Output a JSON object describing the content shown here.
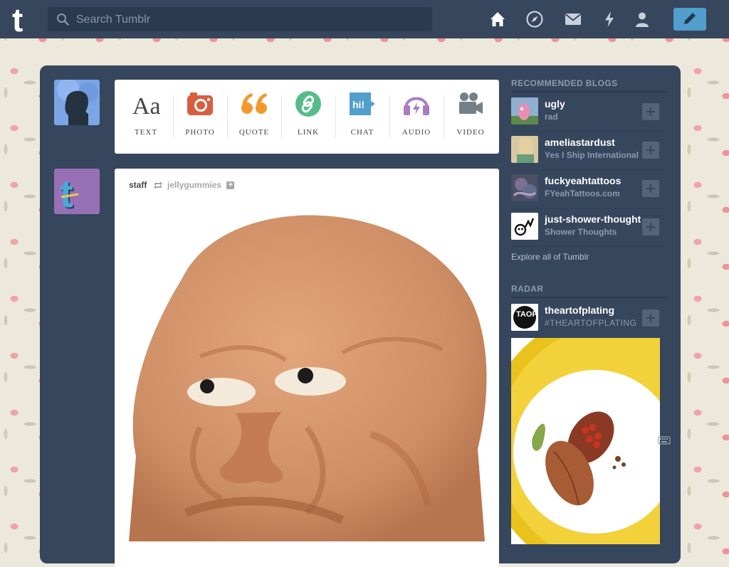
{
  "search": {
    "placeholder": "Search Tumblr"
  },
  "nav": {
    "icons": [
      "home-icon",
      "explore-compass-icon",
      "inbox-envelope-icon",
      "activity-lightning-icon",
      "account-person-icon",
      "compose-pencil-icon"
    ]
  },
  "post_types": [
    {
      "label": "TEXT",
      "icon": "text-aa-icon",
      "color": "#444444"
    },
    {
      "label": "PHOTO",
      "icon": "camera-icon",
      "color": "#d95e40"
    },
    {
      "label": "QUOTE",
      "icon": "quote-icon",
      "color": "#f2992e"
    },
    {
      "label": "LINK",
      "icon": "link-icon",
      "color": "#56bc8a"
    },
    {
      "label": "CHAT",
      "icon": "chat-bubble-icon",
      "color": "#529ecc"
    },
    {
      "label": "AUDIO",
      "icon": "headphones-icon",
      "color": "#a77dc2"
    },
    {
      "label": "VIDEO",
      "icon": "video-camera-icon",
      "color": "#748089"
    }
  ],
  "post": {
    "author": "staff",
    "reblog_source": "jellygummies"
  },
  "sidebar": {
    "recommended_title": "RECOMMENDED BLOGS",
    "recommended": [
      {
        "name": "ugly",
        "subtitle": "rad"
      },
      {
        "name": "ameliastardust",
        "subtitle": "Yes I Ship International"
      },
      {
        "name": "fuckyeahtattoos",
        "subtitle": "FYeahTattoos.com"
      },
      {
        "name": "just-shower-thoughts",
        "subtitle": "Shower Thoughts"
      }
    ],
    "explore_link": "Explore all of Tumblr",
    "radar_title": "RADAR",
    "radar": {
      "name": "theartofplating",
      "subtitle": "#THEARTOFPLATING",
      "logo_text": "TAOP"
    }
  },
  "colors": {
    "topbar": "#36465d",
    "dashboard": "#36465d",
    "accent": "#529ecc",
    "sidebar_text": "#8d9ab0"
  }
}
